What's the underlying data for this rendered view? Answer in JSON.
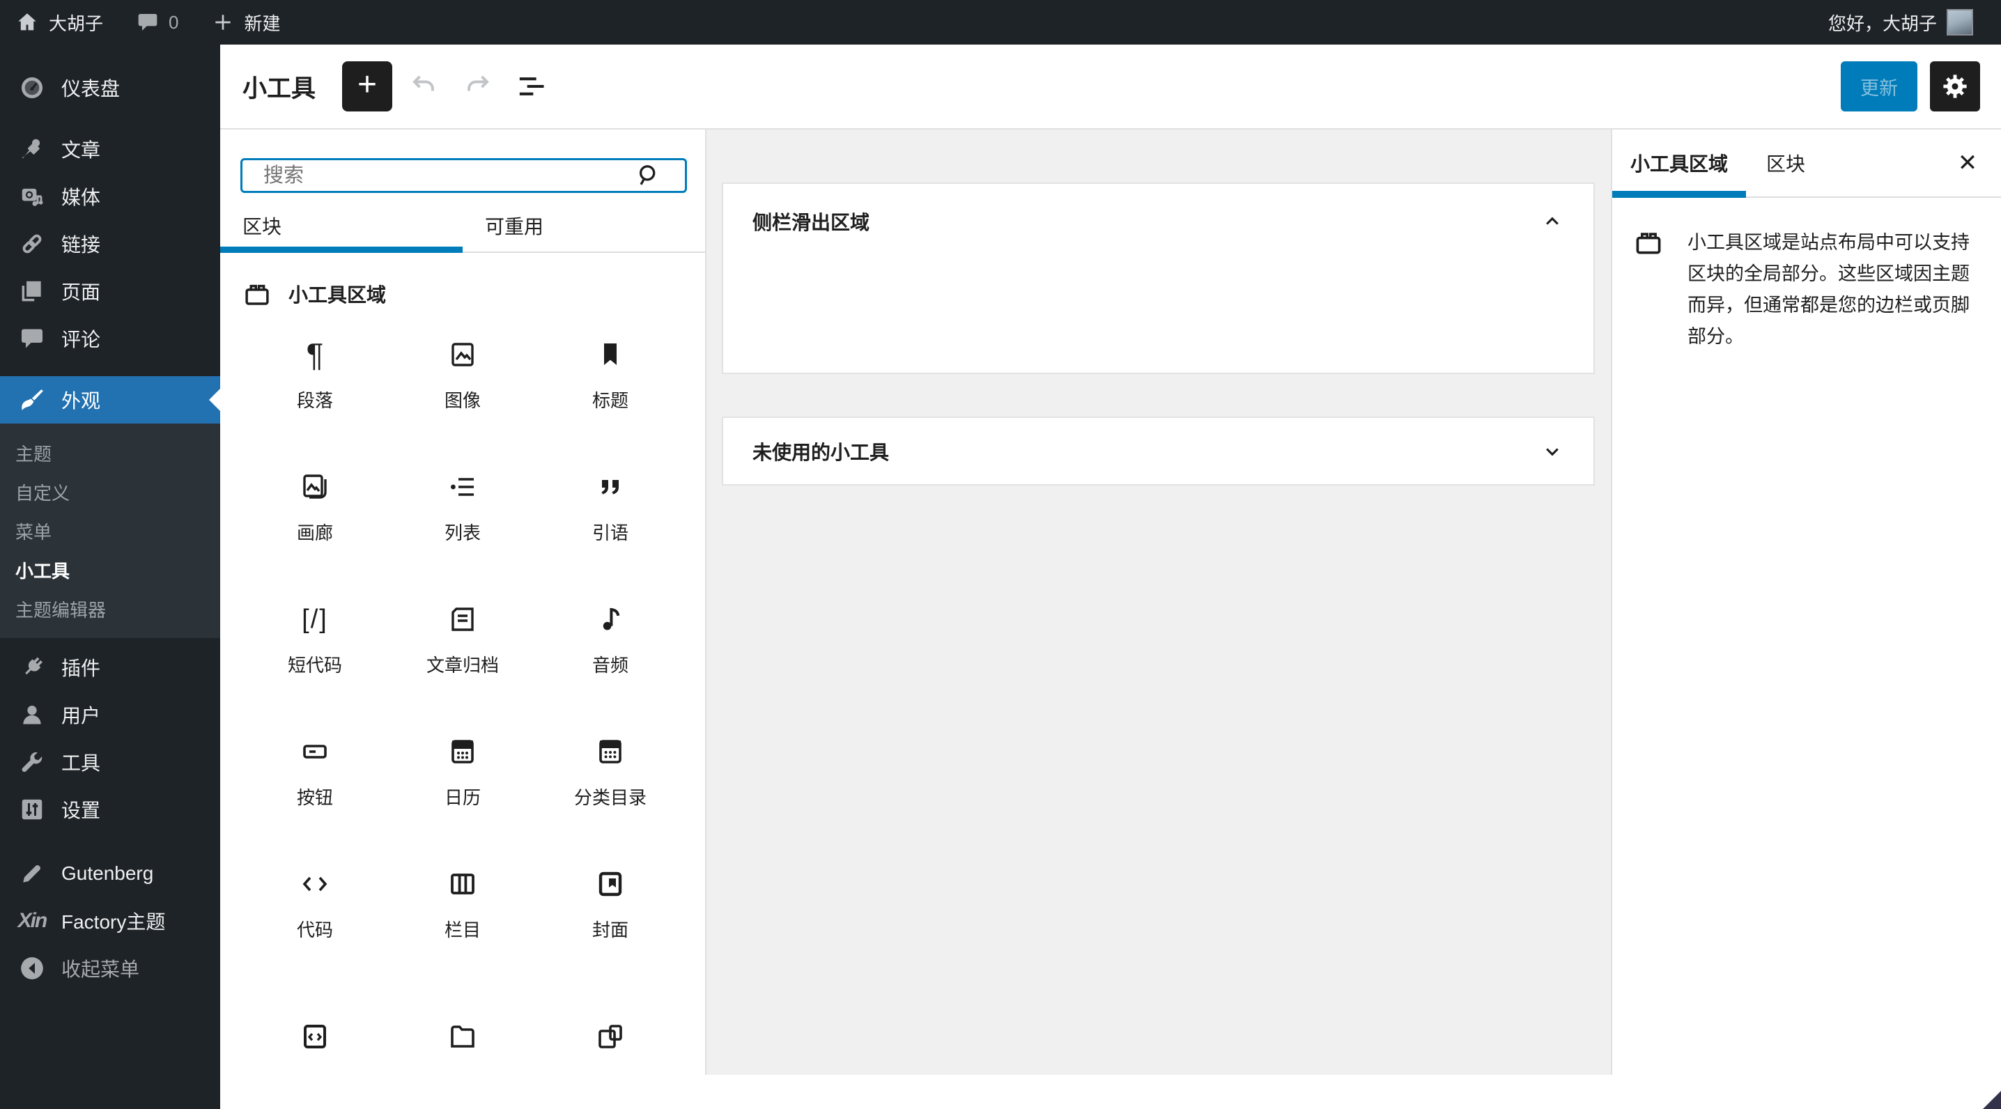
{
  "adminbar": {
    "site_name": "大胡子",
    "comment_count": "0",
    "new_label": "新建",
    "greeting": "您好，大胡子"
  },
  "menu": {
    "items": {
      "dashboard": "仪表盘",
      "posts": "文章",
      "media": "媒体",
      "links": "链接",
      "pages": "页面",
      "comments": "评论",
      "appearance": "外观",
      "plugins": "插件",
      "users": "用户",
      "tools": "工具",
      "settings": "设置",
      "gutenberg": "Gutenberg",
      "xin_theme": "Factory主题",
      "collapse": "收起菜单"
    },
    "xin_logo": "Xin",
    "submenu": [
      "主题",
      "自定义",
      "菜单",
      "小工具",
      "主题编辑器"
    ],
    "submenu_current": "小工具"
  },
  "header": {
    "title": "小工具",
    "add_label": "+",
    "update_label": "更新"
  },
  "inserter": {
    "search_placeholder": "搜索",
    "tab_blocks": "区块",
    "tab_reusable": "可重用",
    "section_title": "小工具区域",
    "glyph_paragraph": "¶",
    "glyph_shortcode": "[/]",
    "blocks": [
      {
        "label": "段落"
      },
      {
        "label": "图像"
      },
      {
        "label": "标题"
      },
      {
        "label": "画廊"
      },
      {
        "label": "列表"
      },
      {
        "label": "引语"
      },
      {
        "label": "短代码"
      },
      {
        "label": "文章归档"
      },
      {
        "label": "音频"
      },
      {
        "label": "按钮"
      },
      {
        "label": "日历"
      },
      {
        "label": "分类目录"
      },
      {
        "label": "代码"
      },
      {
        "label": "栏目"
      },
      {
        "label": "封面"
      }
    ]
  },
  "editor": {
    "areas": [
      {
        "title": "侧栏滑出区域",
        "state": "expanded"
      },
      {
        "title": "未使用的小工具",
        "state": "collapsed"
      }
    ]
  },
  "panel": {
    "tab_widget_area": "小工具区域",
    "tab_block": "区块",
    "close_label": "✕",
    "description": "小工具区域是站点布局中可以支持区块的全局部分。这些区域因主题而异，但通常都是您的边栏或页脚部分。"
  },
  "colors": {
    "accent": "#007cba",
    "menu_highlight": "#2271b1",
    "admin_dark": "#1d2327",
    "submenu_bg": "#2c3338",
    "icon_gray": "#a7aaad",
    "border": "#e0e0e0",
    "canvas_bg": "#f0f0f0"
  }
}
